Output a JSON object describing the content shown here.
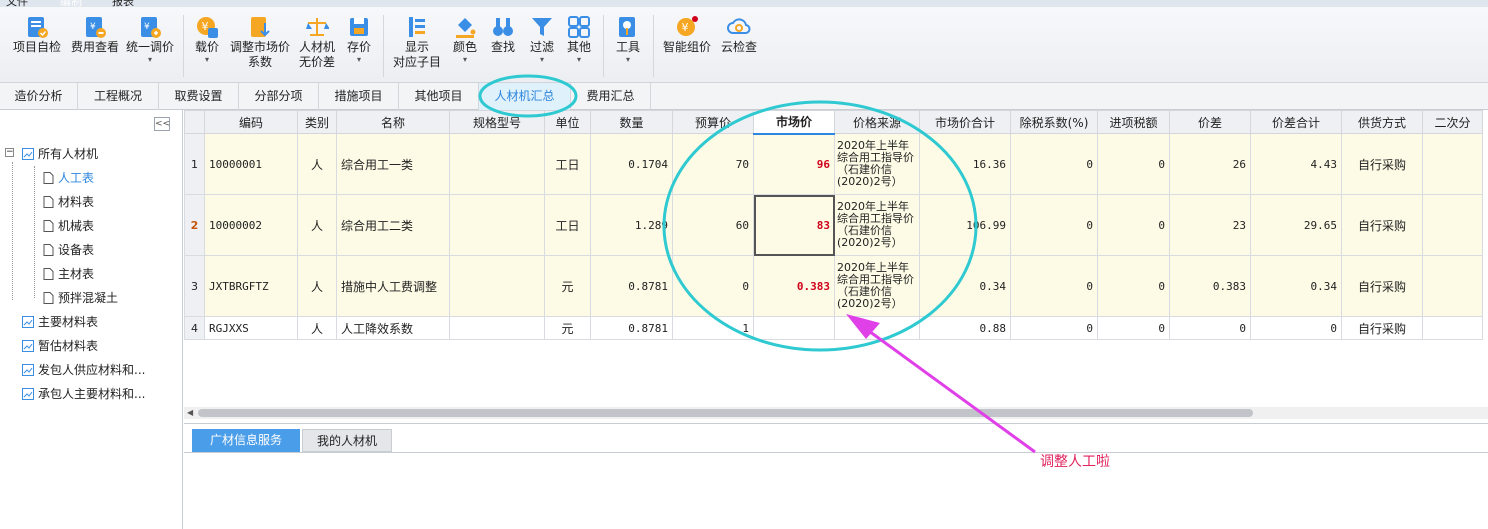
{
  "menu": {
    "items": [
      "文件",
      "编制",
      "报表"
    ]
  },
  "ribbon": {
    "buttons": [
      {
        "label": "项目自检",
        "label2": "",
        "icon": "check-report-icon",
        "dropdown": false
      },
      {
        "label": "费用查看",
        "label2": "",
        "icon": "cost-view-icon",
        "dropdown": false
      },
      {
        "label": "统一调价",
        "label2": "",
        "icon": "adjust-price-icon",
        "dropdown": true
      },
      {
        "label": "载价",
        "label2": "",
        "icon": "load-price-icon",
        "dropdown": true
      },
      {
        "label": "调整市场价",
        "label2": "系数",
        "icon": "market-factor-icon",
        "dropdown": false
      },
      {
        "label": "人材机",
        "label2": "无价差",
        "icon": "scale-icon",
        "dropdown": false
      },
      {
        "label": "存价",
        "label2": "",
        "icon": "save-price-icon",
        "dropdown": true
      },
      {
        "label": "显示",
        "label2": "对应子目",
        "icon": "show-items-icon",
        "dropdown": false
      },
      {
        "label": "颜色",
        "label2": "",
        "icon": "paint-bucket-icon",
        "dropdown": true
      },
      {
        "label": "查找",
        "label2": "",
        "icon": "binoculars-icon",
        "dropdown": false
      },
      {
        "label": "过滤",
        "label2": "",
        "icon": "filter-icon",
        "dropdown": true
      },
      {
        "label": "其他",
        "label2": "",
        "icon": "grid-apps-icon",
        "dropdown": true
      },
      {
        "label": "工具",
        "label2": "",
        "icon": "tools-icon",
        "dropdown": true
      },
      {
        "label": "智能组价",
        "label2": "",
        "icon": "smart-price-icon",
        "dropdown": false
      },
      {
        "label": "云检查",
        "label2": "",
        "icon": "cloud-check-icon",
        "dropdown": false
      }
    ]
  },
  "tabs": [
    "造价分析",
    "工程概况",
    "取费设置",
    "分部分项",
    "措施项目",
    "其他项目",
    "人材机汇总",
    "费用汇总"
  ],
  "active_tab": "人材机汇总",
  "tree": {
    "root": "所有人材机",
    "children": [
      "人工表",
      "材料表",
      "机械表",
      "设备表",
      "主材表",
      "预拌混凝土"
    ],
    "others": [
      "主要材料表",
      "暂估材料表",
      "发包人供应材料和...",
      "承包人主要材料和..."
    ],
    "selected": "人工表"
  },
  "grid": {
    "headers": [
      "编码",
      "类别",
      "名称",
      "规格型号",
      "单位",
      "数量",
      "预算价",
      "市场价",
      "价格来源",
      "市场价合计",
      "除税系数(%)",
      "进项税额",
      "价差",
      "价差合计",
      "供货方式",
      "二次分"
    ],
    "rows": [
      {
        "n": "1",
        "code": "10000001",
        "type": "人",
        "name": "综合用工一类",
        "spec": "",
        "unit": "工日",
        "qty": "0.1704",
        "budget": "70",
        "market": "96",
        "source": "2020年上半年综合用工指导价（石建价信(2020)2号）",
        "total": "16.36",
        "taxrate": "0",
        "tax": "0",
        "diff": "26",
        "difftotal": "4.43",
        "supply": "自行采购"
      },
      {
        "n": "2",
        "code": "10000002",
        "type": "人",
        "name": "综合用工二类",
        "spec": "",
        "unit": "工日",
        "qty": "1.289",
        "budget": "60",
        "market": "83",
        "source": "2020年上半年综合用工指导价（石建价信(2020)2号）",
        "total": "106.99",
        "taxrate": "0",
        "tax": "0",
        "diff": "23",
        "difftotal": "29.65",
        "supply": "自行采购"
      },
      {
        "n": "3",
        "code": "JXTBRGFTZ",
        "type": "人",
        "name": "措施中人工费调整",
        "spec": "",
        "unit": "元",
        "qty": "0.8781",
        "budget": "0",
        "market": "0.383",
        "source": "2020年上半年综合用工指导价（石建价信(2020)2号）",
        "total": "0.34",
        "taxrate": "0",
        "tax": "0",
        "diff": "0.383",
        "difftotal": "0.34",
        "supply": "自行采购"
      },
      {
        "n": "4",
        "code": "RGJXXS",
        "type": "人",
        "name": "人工降效系数",
        "spec": "",
        "unit": "元",
        "qty": "0.8781",
        "budget": "1",
        "market": "",
        "source": "",
        "total": "0.88",
        "taxrate": "0",
        "tax": "0",
        "diff": "0",
        "difftotal": "0",
        "supply": "自行采购"
      }
    ]
  },
  "bottom_tabs": [
    "广材信息服务",
    "我的人材机"
  ],
  "annotation": {
    "text": "调整人工啦"
  },
  "colors": {
    "accent": "#2e86de",
    "highlight_circle": "#2ec9d1",
    "arrow": "#e040e8",
    "red_value": "#d0021b"
  }
}
